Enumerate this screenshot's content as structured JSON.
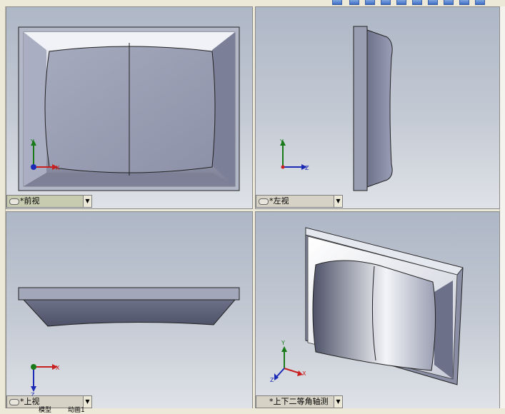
{
  "viewports": {
    "front": {
      "label": "*前视",
      "axes": {
        "up": "Y",
        "right": "X"
      }
    },
    "left": {
      "label": "*左视",
      "axes": {
        "up": "Y",
        "right": "Z"
      }
    },
    "top": {
      "label": "*上视",
      "axes": {
        "down": "Z",
        "right": "X"
      }
    },
    "iso": {
      "label": "*上下二等角轴测",
      "axes": {
        "up": "Y",
        "right": "X",
        "left": "Z"
      }
    }
  },
  "bottom_tabs": [
    "模型",
    "动画1"
  ],
  "colors": {
    "viewport_top": "#aeb7c6",
    "viewport_bottom": "#dfe2e7",
    "part_face": "#8a8fa6",
    "frame": "#9a9eb2"
  }
}
